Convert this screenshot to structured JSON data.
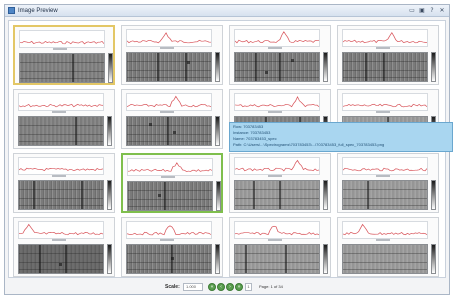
{
  "window": {
    "title": "Image Preview",
    "controls": [
      "pin-icon",
      "restore-icon",
      "help-icon",
      "close-icon"
    ]
  },
  "tooltip": {
    "lines": [
      "Row: 703783453",
      "Instance: 703783453",
      "Name: 703783453_spec",
      "Path: C:\\Users\\...\\Spectrograms\\703783453\\...\\703783453_full_spec_703783453.png"
    ]
  },
  "footer": {
    "scale_label": "Scale:",
    "scale_value": "1.000",
    "nav_buttons": [
      "first-page",
      "previous-page",
      "next-page",
      "last-page"
    ],
    "page_input": "1",
    "page_text": "Page: 1 of 34"
  },
  "selection_colors": {
    "primary": "#e3c766",
    "secondary": "#7fbf4d"
  },
  "tooltip_color": "#a9d6f0"
}
